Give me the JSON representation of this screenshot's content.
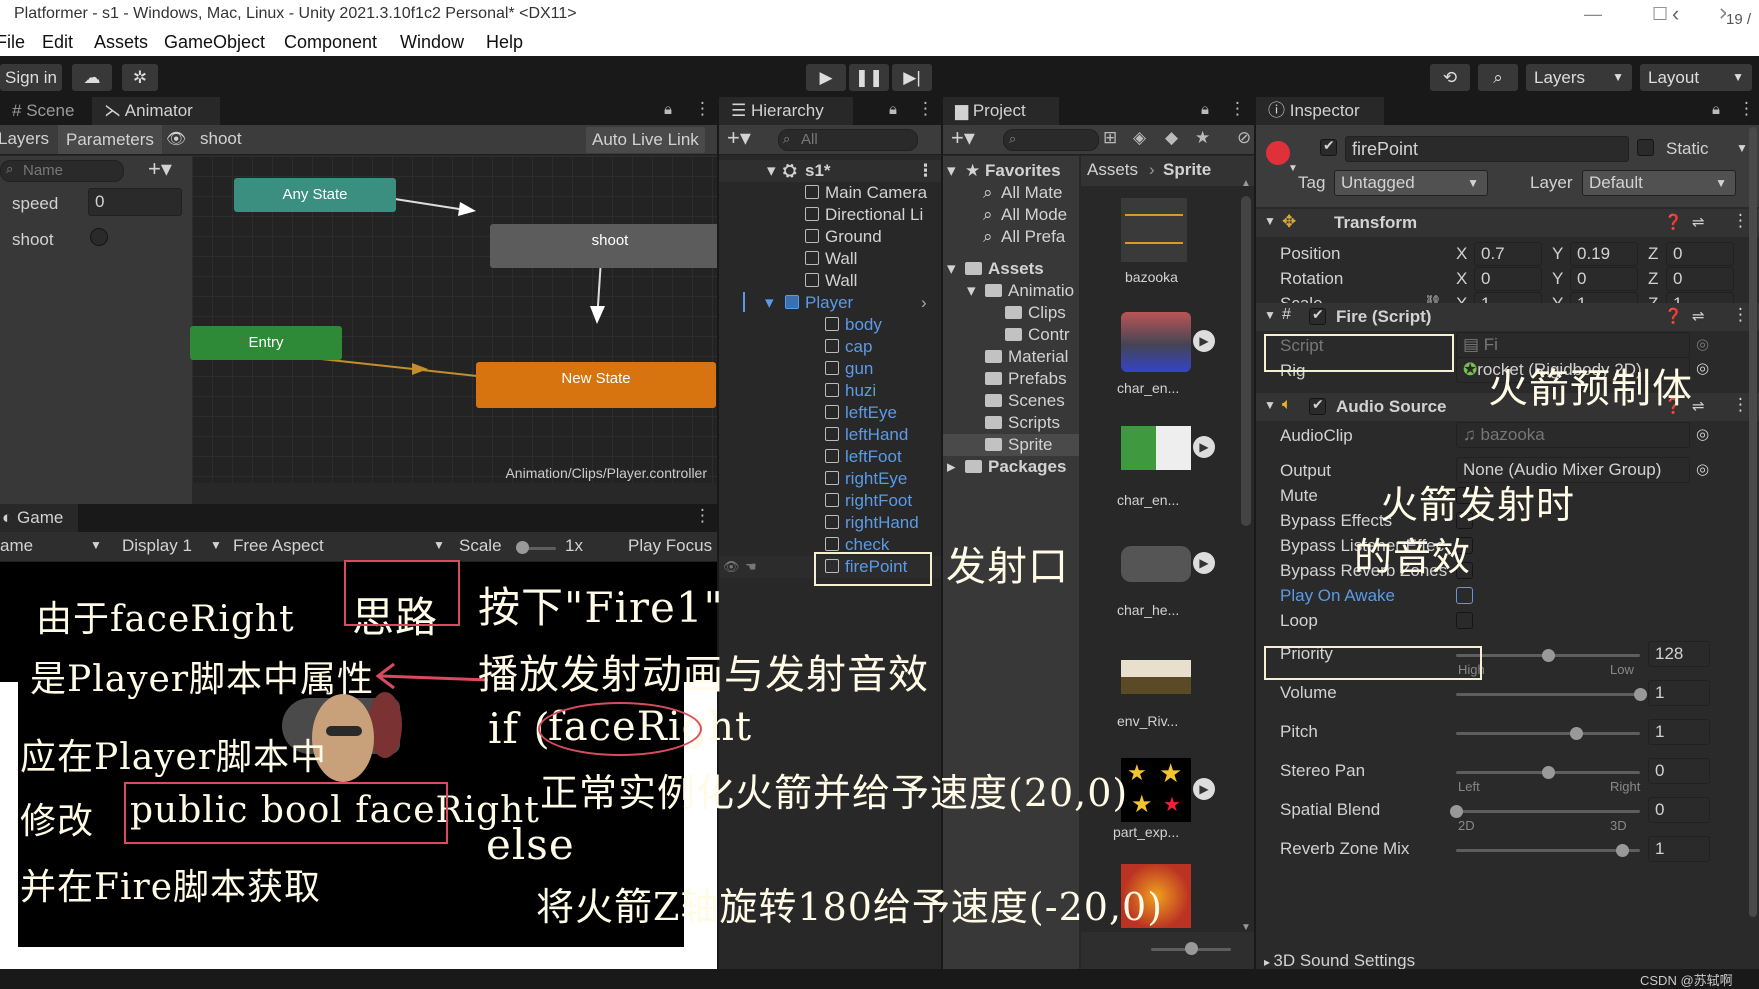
{
  "window": {
    "title": "Platformer - s1 - Windows, Mac, Linux - Unity 2021.3.10f1c2 Personal* <DX11>",
    "corner_badge": "19 /"
  },
  "menu": [
    "File",
    "Edit",
    "Assets",
    "GameObject",
    "Component",
    "Window",
    "Help"
  ],
  "toolbar": {
    "sign_in": "Sign in",
    "layers": "Layers",
    "layout": "Layout"
  },
  "animator": {
    "tabs": {
      "scene": "Scene",
      "animator": "Animator"
    },
    "sub_tabs": {
      "layers": "Layers",
      "parameters": "Parameters",
      "breadcrumb": "shoot",
      "auto_live_link": "Auto Live Link"
    },
    "search_placeholder": "Name",
    "parameters": [
      {
        "name": "speed",
        "value": "0"
      },
      {
        "name": "shoot"
      }
    ],
    "nodes": {
      "any_state": "Any State",
      "shoot": "shoot",
      "entry": "Entry",
      "new_state": "New State"
    },
    "footer_path": "Animation/Clips/Player.controller"
  },
  "game": {
    "tab": "Game",
    "bar": {
      "game_dropdown": "ame",
      "display": "Display 1",
      "aspect": "Free Aspect",
      "scale_label": "Scale",
      "scale_value": "1x",
      "play_focus": "Play Focus"
    }
  },
  "hierarchy": {
    "tab": "Hierarchy",
    "search_placeholder": "All",
    "scene": "s1*",
    "items": [
      "Main Camera",
      "Directional Li",
      "Ground",
      "Wall",
      "Wall",
      "Player",
      "body",
      "cap",
      "gun",
      "huzi",
      "leftEye",
      "leftHand",
      "leftFoot",
      "rightEye",
      "rightFoot",
      "rightHand",
      "check",
      "firePoint"
    ]
  },
  "project": {
    "tab": "Project",
    "favorites": {
      "header": "Favorites",
      "items": [
        "All Mate",
        "All Mode",
        "All Prefa"
      ]
    },
    "assets": {
      "header": "Assets",
      "folders": [
        "Animatio",
        "Clips",
        "Contr",
        "Material",
        "Prefabs",
        "Scenes",
        "Scripts",
        "Sprite"
      ]
    },
    "packages": "Packages",
    "breadcrumb": [
      "Assets",
      "Sprite"
    ],
    "thumbnails": [
      "bazooka",
      "char_en...",
      "char_en...",
      "char_he...",
      "env_Riv...",
      "part_exp..."
    ]
  },
  "inspector": {
    "tab": "Inspector",
    "object_name": "firePoint",
    "static_label": "Static",
    "tag_label": "Tag",
    "tag_value": "Untagged",
    "layer_label": "Layer",
    "layer_value": "Default",
    "transform": {
      "title": "Transform",
      "rows": [
        {
          "label": "Position",
          "x": "0.7",
          "y": "0.19",
          "z": "0"
        },
        {
          "label": "Rotation",
          "x": "0",
          "y": "0",
          "z": "0"
        },
        {
          "label": "Scale",
          "x": "1",
          "y": "1",
          "z": "1"
        }
      ]
    },
    "fire_script": {
      "title": "Fire (Script)",
      "script_label": "Script",
      "script_value": "Fi",
      "rig_label": "Rig",
      "rig_value": "rocket (Rigidbody 2D)"
    },
    "audio_source": {
      "title": "Audio Source",
      "audioclip_label": "AudioClip",
      "audioclip_value": "bazooka",
      "output_label": "Output",
      "output_value": "None (Audio Mixer Group)",
      "toggles": [
        "Mute",
        "Bypass Effects",
        "Bypass Listener Effec",
        "Bypass Reverb Zones",
        "Play On Awake",
        "Loop"
      ],
      "sliders": [
        {
          "label": "Priority",
          "value": "128",
          "min_label": "High",
          "max_label": "Low",
          "fraction": 0.5
        },
        {
          "label": "Volume",
          "value": "1",
          "fraction": 1.0
        },
        {
          "label": "Pitch",
          "value": "1",
          "fraction": 0.65
        },
        {
          "label": "Stereo Pan",
          "value": "0",
          "min_label": "Left",
          "max_label": "Right",
          "fraction": 0.5
        },
        {
          "label": "Spatial Blend",
          "value": "0",
          "min_label": "2D",
          "max_label": "3D",
          "fraction": 0.0
        },
        {
          "label": "Reverb Zone Mix",
          "value": "1",
          "fraction": 0.9
        }
      ],
      "sound_3d": "3D Sound Settings"
    }
  },
  "annotations": {
    "left_lines": [
      "由于faceRight",
      "是Player脚本中属性",
      "应在Player脚本中",
      "修改",
      "public bool faceRight",
      "并在Fire脚本获取"
    ],
    "idea": "思路",
    "press_fire": "按下\"Fire1\"",
    "play_anim": "播放发射动画与发射音效",
    "if_kw": "if (",
    "if_cond": "faceRight",
    "if_close": ")",
    "if_body": "正常实例化火箭并给予速度(20,0)",
    "else_kw": "else",
    "else_body": "将火箭Z轴旋转180给予速度(-20,0)",
    "fire_point": "发射口",
    "rocket_prefab": "火箭预制体",
    "rocket_sound_1": "火箭发射时",
    "rocket_sound_2": "的音效"
  },
  "watermark": "CSDN @苏轼啊"
}
